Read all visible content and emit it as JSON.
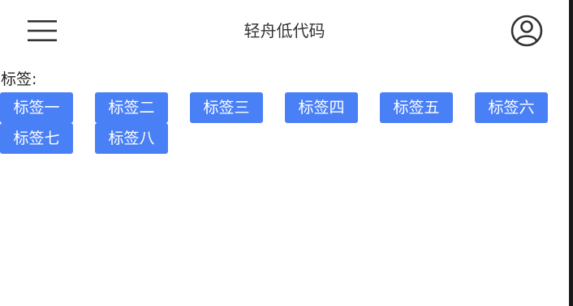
{
  "header": {
    "title": "轻舟低代码",
    "menu_icon": "hamburger-menu-icon",
    "user_icon": "user-avatar-icon"
  },
  "tags_section": {
    "label": "标签:",
    "tags": [
      {
        "label": "标签一"
      },
      {
        "label": "标签二"
      },
      {
        "label": "标签三"
      },
      {
        "label": "标签四"
      },
      {
        "label": "标签五"
      },
      {
        "label": "标签六"
      },
      {
        "label": "标签七"
      },
      {
        "label": "标签八"
      }
    ]
  },
  "colors": {
    "tag_background": "#4a80f5",
    "tag_text": "#ffffff",
    "title_text": "#333333"
  }
}
